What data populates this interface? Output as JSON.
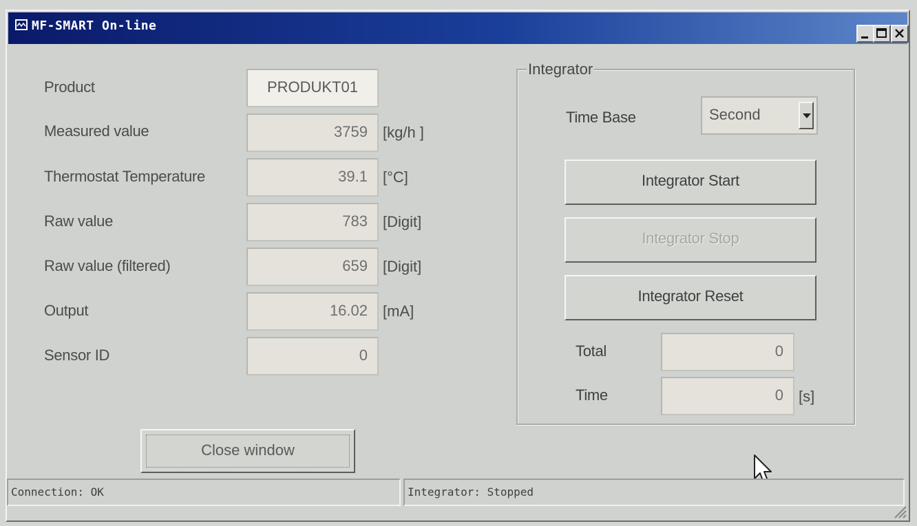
{
  "window": {
    "title": "MF-SMART On-line"
  },
  "fields": [
    {
      "label": "Product",
      "value": "PRODUKT01",
      "unit": ""
    },
    {
      "label": "Measured value",
      "value": "3759",
      "unit": "[kg/h ]"
    },
    {
      "label": "Thermostat Temperature",
      "value": "39.1",
      "unit": "[°C]"
    },
    {
      "label": "Raw value",
      "value": "783",
      "unit": "[Digit]"
    },
    {
      "label": "Raw value (filtered)",
      "value": "659",
      "unit": "[Digit]"
    },
    {
      "label": "Output",
      "value": "16.02",
      "unit": "[mA]"
    },
    {
      "label": "Sensor ID",
      "value": "0",
      "unit": ""
    }
  ],
  "integrator": {
    "group_title": "Integrator",
    "time_base_label": "Time Base",
    "time_base_value": "Second",
    "start_label": "Integrator Start",
    "stop_label": "Integrator Stop",
    "reset_label": "Integrator Reset",
    "total_label": "Total",
    "total_value": "0",
    "time_label": "Time",
    "time_value": "0",
    "time_unit": "[s]"
  },
  "close_label": "Close window",
  "status": {
    "connection": "Connection: OK",
    "integrator": "Integrator: Stopped"
  },
  "icons": [
    "app-icon",
    "minimize-icon",
    "maximize-icon",
    "close-icon",
    "dropdown-arrow-icon",
    "mouse-cursor-icon",
    "resize-grip-icon"
  ]
}
